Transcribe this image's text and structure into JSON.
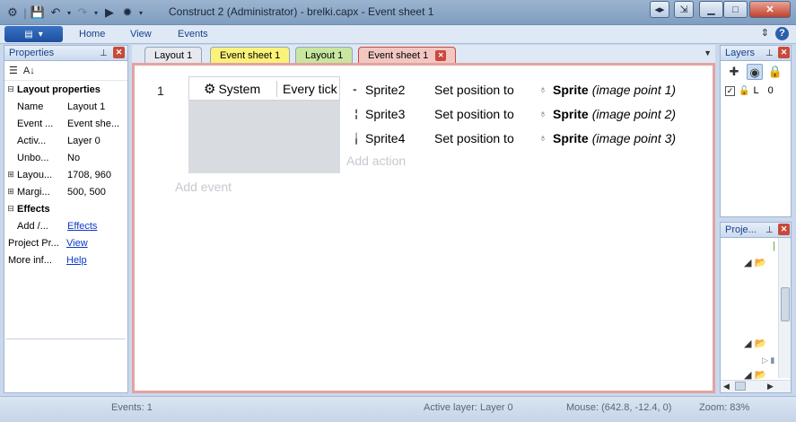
{
  "window": {
    "title": "Construct 2 (Administrator) - brelki.capx - Event sheet 1"
  },
  "ribbon": {
    "tabs": [
      "Home",
      "View",
      "Events"
    ]
  },
  "properties_pane": {
    "title": "Properties",
    "rows": [
      {
        "name": "Layout properties",
        "value": "",
        "section": true,
        "expander": "minus"
      },
      {
        "name": "Name",
        "value": "Layout 1"
      },
      {
        "name": "Event ...",
        "value": "Event she..."
      },
      {
        "name": "Activ...",
        "value": "Layer 0"
      },
      {
        "name": "Unbo...",
        "value": "No"
      },
      {
        "name": "Layou...",
        "value": "1708, 960",
        "expander": "plus"
      },
      {
        "name": "Margi...",
        "value": "500, 500",
        "expander": "plus"
      },
      {
        "name": "Effects",
        "value": "",
        "section": true,
        "expander": "minus"
      },
      {
        "name": "Add /...",
        "value": "Effects",
        "link": true
      },
      {
        "name": "Project Pr...",
        "value": "View",
        "link": true,
        "indent": false
      },
      {
        "name": "More inf...",
        "value": "Help",
        "link": true,
        "indent": false
      }
    ]
  },
  "doc_tabs": [
    {
      "label": "Layout 1",
      "color": "#e6e9ee",
      "active": false
    },
    {
      "label": "Event sheet 1",
      "color": "#fbf27a",
      "active": false
    },
    {
      "label": "Layout 1",
      "color": "#c8e6a0",
      "active": false
    },
    {
      "label": "Event sheet 1",
      "color": "#f2c7c2",
      "active": true
    }
  ],
  "event_sheet": {
    "event_number": "1",
    "condition": {
      "object": "System",
      "text": "Every tick"
    },
    "add_event_label": "Add event",
    "add_action_label": "Add action",
    "actions": [
      {
        "object": "Sprite2",
        "text": "Set position to",
        "param_object": "Sprite",
        "param_detail": "(image point 1)"
      },
      {
        "object": "Sprite3",
        "text": "Set position to",
        "param_object": "Sprite",
        "param_detail": "(image point 2)"
      },
      {
        "object": "Sprite4",
        "text": "Set position to",
        "param_object": "Sprite",
        "param_detail": "(image point 3)"
      }
    ]
  },
  "layers_pane": {
    "title": "Layers",
    "layers": [
      {
        "lock_label": "L",
        "name": "0"
      }
    ]
  },
  "projects_pane": {
    "title": "Proje..."
  },
  "status_bar": {
    "events": "Events: 1",
    "active_layer": "Active layer: Layer 0",
    "mouse": "Mouse: (642.8, -12.4, 0)",
    "zoom": "Zoom: 83%"
  },
  "colors": {
    "sheet_border": "#e3a3a0",
    "link": "#0b38c9",
    "placeholder_text": "#c5c9cf"
  }
}
